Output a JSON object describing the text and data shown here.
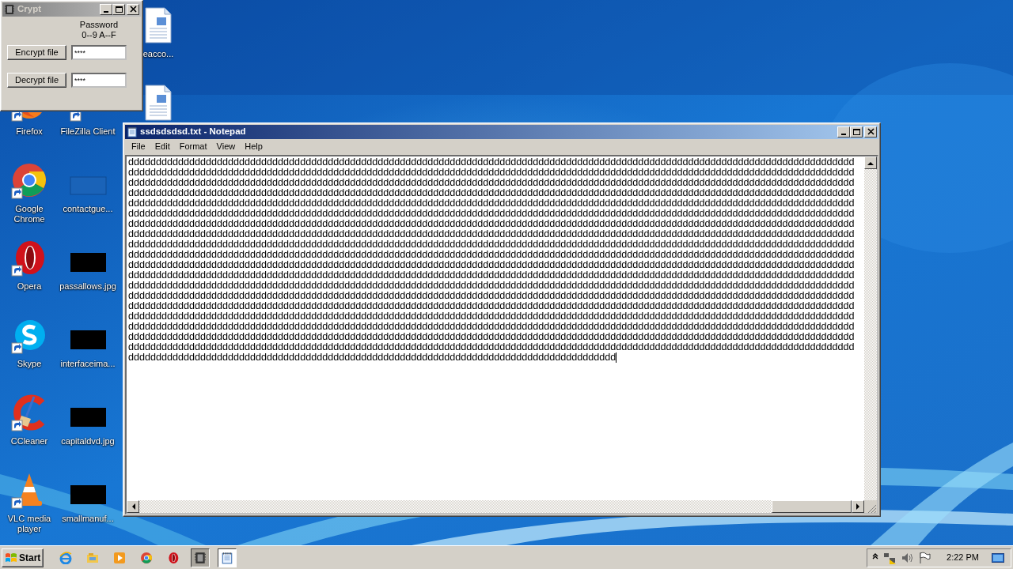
{
  "desktop_columns": [
    [
      {
        "label": "Firefox",
        "kind": "firefox",
        "shortcut": true
      },
      {
        "label": "Google Chrome",
        "kind": "chrome",
        "shortcut": true
      },
      {
        "label": "Opera",
        "kind": "opera",
        "shortcut": true
      },
      {
        "label": "Skype",
        "kind": "skype",
        "shortcut": true
      },
      {
        "label": "CCleaner",
        "kind": "ccleaner",
        "shortcut": true
      },
      {
        "label": "VLC media player",
        "kind": "vlc",
        "shortcut": true
      }
    ],
    [
      {
        "label": "FileZilla Client",
        "kind": "filezilla",
        "shortcut": true
      },
      {
        "label": "contactgue...",
        "kind": "thumb-blue",
        "shortcut": false
      },
      {
        "label": "passallows.jpg",
        "kind": "thumb-black",
        "shortcut": false
      },
      {
        "label": "interfaceima...",
        "kind": "thumb-black",
        "shortcut": false
      },
      {
        "label": "capitaldvd.jpg",
        "kind": "thumb-black",
        "shortcut": false
      },
      {
        "label": "smallmanuf...",
        "kind": "thumb-black",
        "shortcut": false
      }
    ],
    [
      {
        "label": "eacco...",
        "kind": "document",
        "shortcut": false
      },
      {
        "kind": "document",
        "shortcut": false
      }
    ]
  ],
  "crypt_window": {
    "title": "Crypt",
    "active": false,
    "password_label": [
      "Password",
      "0--9 A--F"
    ],
    "rows": [
      {
        "button": "Encrypt file",
        "value": "****"
      },
      {
        "button": "Decrypt file",
        "value": "****"
      }
    ]
  },
  "notepad": {
    "title": "ssdsdsdsd.txt - Notepad",
    "active": true,
    "menu": [
      "File",
      "Edit",
      "Format",
      "View",
      "Help"
    ],
    "lines": [
      "ddddddddddddddddddddddddddddddddddddddddddddddddddddddddddddddddddddddddddddddddddddddddddddddddddddddddddddddddddddddddddddddddddd",
      "ddddddddddddddddddddddddddddddddddddddddddddddddddddddddddddddddddddddddddddddddddddddddddddddddddddddddddddddddddddddddddddddddddd",
      "ddddddddddddddddddddddddddddddddddddddddddddddddddddddddddddddddddddddddddddddddddddddddddddddddddddddddddddddddddddddddddddddddddd",
      "ddddddddddddddddddddddddddddddddddddddddddddddddddddddddddddddddddddddddddddddddddddddddddddddddddddddddddddddddddddddddddddddddddd",
      "ddddddddddddddddddddddddddddddddddddddddddddddddddddddddddddddddddddddddddddddddddddddddddddddddddddddddddddddddddddddddddddddddddd",
      "ddddddddddddddddddddddddddddddddddddddddddddddddddddddddddddddddddddddddddddddddddddddddddddddddddddddddddddddddddddddddddddddddddd",
      "ddddddddddddddddddddddddddddddddddddddddddddddddddddddddddddddddddddddddddddddddddddddddddddddddddddddddddddddddddddddddddddddddddd",
      "ddddddddddddddddddddddddddddddddddddddddddddddddddddddddddddddddddddddddddddddddddddddddddddddddddddddddddddddddddddddddddddddddddd",
      "ddddddddddddddddddddddddddddddddddddddddddddddddddddddddddddddddddddddddddddddddddddddddddddddddddddddddddddddddddddddddddddddddddd",
      "ddddddddddddddddddddddddddddddddddddddddddddddddddddddddddddddddddddddddddddddddddddddddddddddddddddddddddddddddddddddddddddddddddd",
      "ddddddddddddddddddddddddddddddddddddddddddddddddddddddddddddddddddddddddddddddddddddddddddddddddddddddddddddddddddddddddddddddddddd",
      "ddddddddddddddddddddddddddddddddddddddddddddddddddddddddddddddddddddddddddddddddddddddddddddddddddddddddddddddddddddddddddddddddddd",
      "ddddddddddddddddddddddddddddddddddddddddddddddddddddddddddddddddddddddddddddddddddddddddddddddddddddddddddddddddddddddddddddddddddd",
      "ddddddddddddddddddddddddddddddddddddddddddddddddddddddddddddddddddddddddddddddddddddddddddddddddddddddddddddddddddddddddddddddddddd",
      "ddddddddddddddddddddddddddddddddddddddddddddddddddddddddddddddddddddddddddddddddddddddddddddddddddddddddddddddddddddddddddddddddddd",
      "ddddddddddddddddddddddddddddddddddddddddddddddddddddddddddddddddddddddddddddddddddddddddddddddddddddddddddddddddddddddddddddddddddd",
      "ddddddddddddddddddddddddddddddddddddddddddddddddddddddddddddddddddddddddddddddddddddddddddddddddddddddddddddddddddddddddddddddddddd",
      "ddddddddddddddddddddddddddddddddddddddddddddddddddddddddddddddddddddddddddddddddddddddddddddddddddddddddddddddddddddddddddddddddddd",
      "ddddddddddddddddddddddddddddddddddddddddddddddddddddddddddddddddddddddddddddddddddddddddddddddddddddddddddddddddddddddddddddddddddd",
      "dddddddddddddddddddddddddddddddddddddddddddddddddddddddddddddddddddddddddddddddddddddddd"
    ]
  },
  "taskbar": {
    "start": "Start",
    "apps": [
      {
        "kind": "ie",
        "open": false,
        "selected": false
      },
      {
        "kind": "explorer",
        "open": false,
        "selected": false
      },
      {
        "kind": "media",
        "open": false,
        "selected": false
      },
      {
        "kind": "chrome",
        "open": false,
        "selected": false
      },
      {
        "kind": "opera",
        "open": false,
        "selected": false
      },
      {
        "kind": "crypt",
        "open": true,
        "selected": false
      },
      {
        "kind": "notepad",
        "open": true,
        "selected": true
      }
    ],
    "tray": [
      {
        "kind": "chevron"
      },
      {
        "kind": "network"
      },
      {
        "kind": "volume"
      },
      {
        "kind": "flag"
      }
    ],
    "clock": "2:22 PM"
  }
}
